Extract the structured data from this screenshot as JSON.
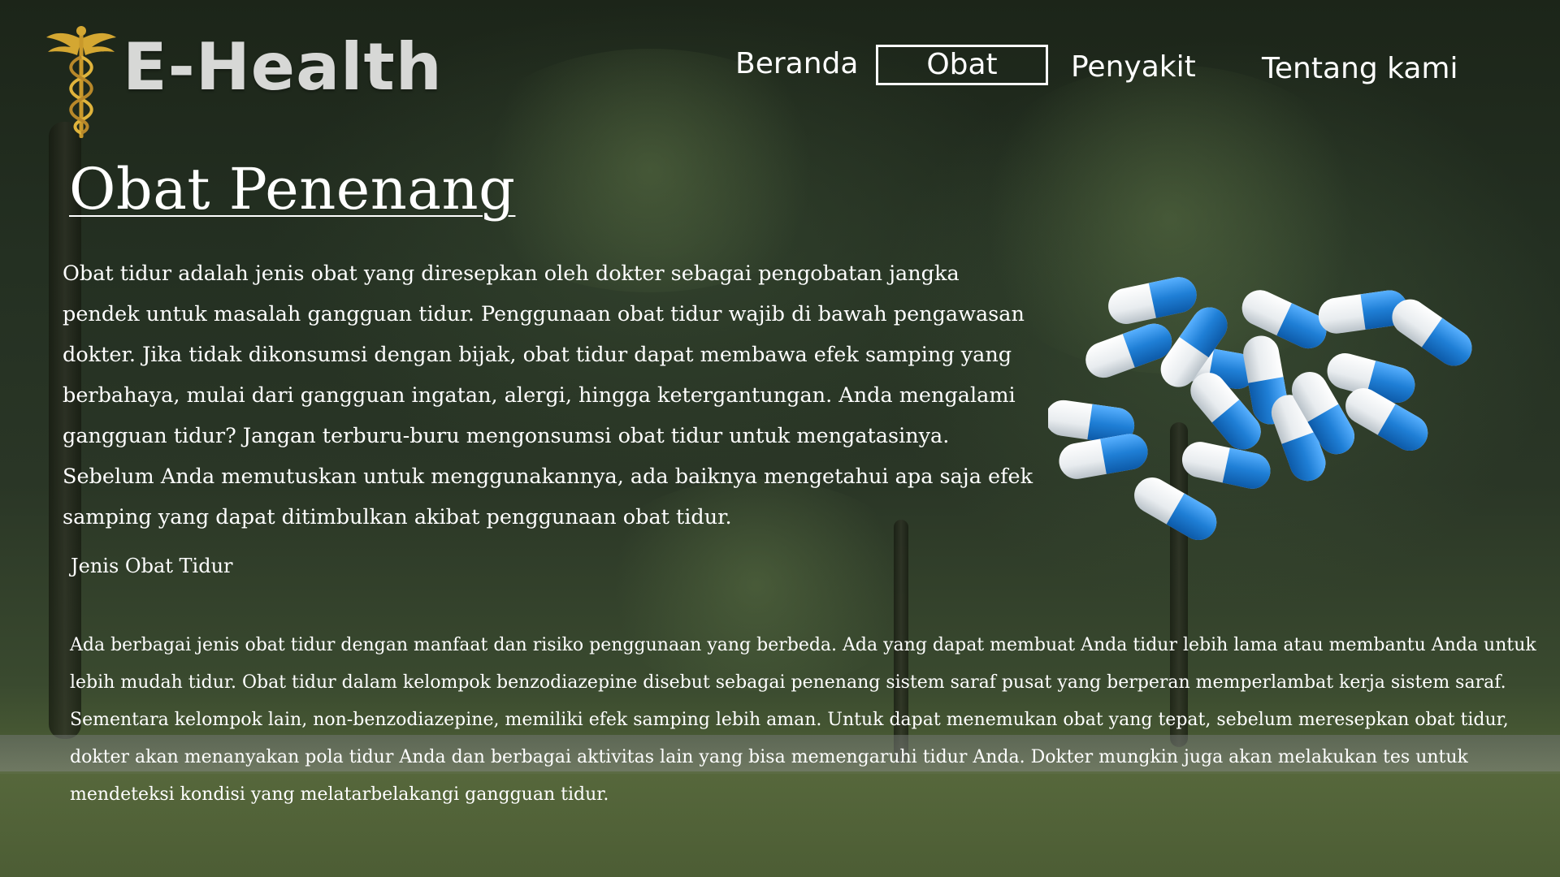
{
  "brand": {
    "name": "E-Health",
    "logo_icon": "caduceus-icon",
    "logo_color": "#d4a732"
  },
  "nav": {
    "items": [
      {
        "label": "Beranda",
        "active": false
      },
      {
        "label": "Obat",
        "active": true
      },
      {
        "label": "Penyakit",
        "active": false
      },
      {
        "label": "Tentang kami",
        "active": false
      }
    ]
  },
  "article": {
    "title": "Obat Penenang",
    "intro": "Obat tidur adalah jenis obat yang diresepkan oleh dokter sebagai pengobatan jangka pendek untuk masalah gangguan tidur. Penggunaan obat tidur wajib di bawah pengawasan dokter. Jika tidak dikonsumsi dengan bijak, obat tidur dapat membawa efek samping yang berbahaya, mulai dari gangguan ingatan, alergi, hingga ketergantungan. Anda mengalami gangguan tidur? Jangan terburu-buru mengonsumsi obat tidur untuk mengatasinya. Sebelum Anda memutuskan untuk menggunakannya, ada baiknya mengetahui apa saja efek samping yang dapat ditimbulkan akibat penggunaan obat tidur.",
    "subheading": "Jenis Obat Tidur",
    "body": "Ada berbagai jenis obat tidur dengan manfaat dan risiko penggunaan yang berbeda. Ada yang dapat membuat Anda tidur lebih lama atau membantu Anda untuk lebih mudah tidur. Obat tidur dalam kelompok benzodiazepine disebut sebagai penenang sistem saraf pusat yang berperan memperlambat kerja sistem saraf. Sementara kelompok lain, non-benzodiazepine, memiliki efek samping lebih aman. Untuk dapat menemukan obat yang tepat, sebelum meresepkan obat tidur, dokter akan menanyakan pola tidur Anda dan berbagai aktivitas lain yang bisa memengaruhi tidur Anda. Dokter mungkin juga akan melakukan tes untuk mendeteksi kondisi yang melatarbelakangi gangguan tidur.",
    "image": "capsule-pills-image"
  },
  "colors": {
    "pill_blue": "#1f7fd6",
    "pill_white": "#f2f4f6"
  }
}
